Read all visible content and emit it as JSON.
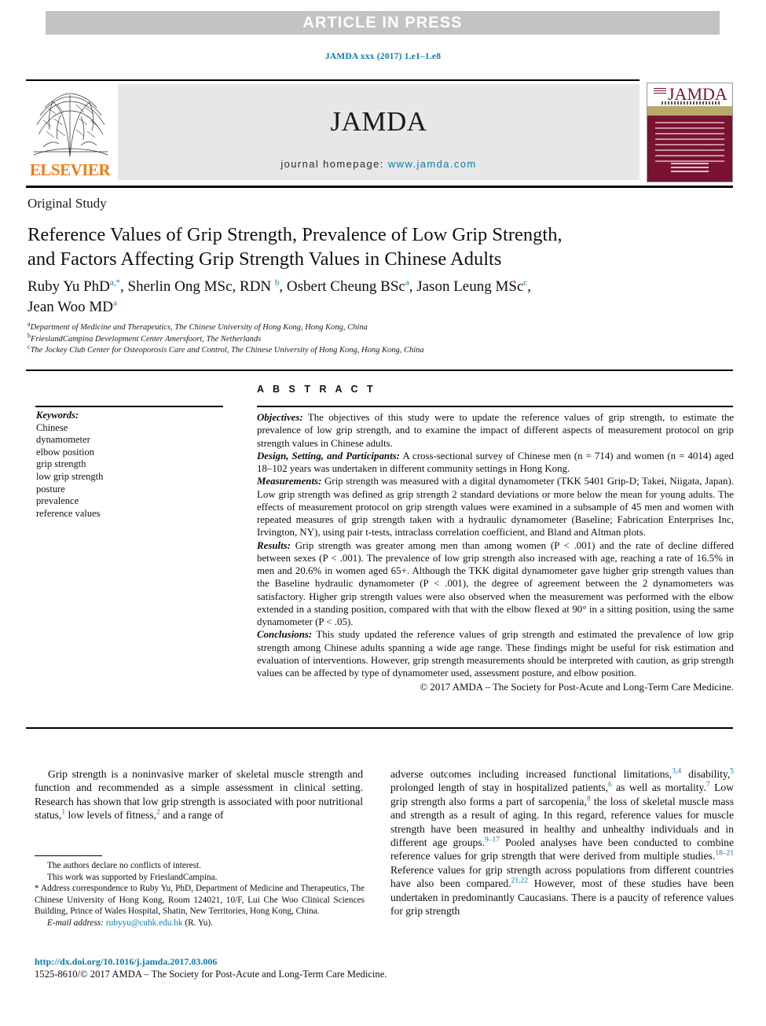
{
  "banner": {
    "text": "ARTICLE IN PRESS",
    "background": "#c3c3c3"
  },
  "citation": {
    "text": "JAMDA xxx (2017) 1.e1–1.e8",
    "color": "#0f7ba8"
  },
  "masthead": {
    "publisher": "ELSEVIER",
    "publisher_color": "#ef7c18",
    "journal_wordmark": "JAMDA",
    "homepage_label": "journal homepage:",
    "homepage_url": "www.jamda.com",
    "cover_title": "JAMDA",
    "cover_band_color": "#b5a96b",
    "cover_body_color": "#7a1330"
  },
  "article": {
    "section_label": "Original Study",
    "title_line1": "Reference Values of Grip Strength, Prevalence of Low Grip Strength,",
    "title_line2": "and Factors Affecting Grip Strength Values in Chinese Adults",
    "authors": [
      {
        "name": "Ruby Yu PhD",
        "sup": "a,*",
        "sep": ", "
      },
      {
        "name": "Sherlin Ong MSc, RDN",
        "sup": "b",
        "sep": ", "
      },
      {
        "name": "Osbert Cheung BSc",
        "sup": "a",
        "sep": ", "
      },
      {
        "name": "Jason Leung MSc",
        "sup": "c",
        "sep": ","
      },
      {
        "name": "Jean Woo MD",
        "sup": "a",
        "sep": ""
      }
    ],
    "affiliations": [
      {
        "marker": "a",
        "text": "Department of Medicine and Therapeutics, The Chinese University of Hong Kong, Hong Kong, China"
      },
      {
        "marker": "b",
        "text": "FrieslandCampina Development Center Amersfoort, The Netherlands"
      },
      {
        "marker": "c",
        "text": "The Jockey Club Center for Osteoporosis Care and Control, The Chinese University of Hong Kong, Hong Kong, China"
      }
    ]
  },
  "keywords": {
    "heading": "Keywords:",
    "items": [
      "Chinese",
      "dynamometer",
      "elbow position",
      "grip strength",
      "low grip strength",
      "posture",
      "prevalence",
      "reference values"
    ]
  },
  "abstract": {
    "heading": "A B S T R A C T",
    "sections": [
      {
        "label": "Objectives:",
        "body": " The objectives of this study were to update the reference values of grip strength, to estimate the prevalence of low grip strength, and to examine the impact of different aspects of measurement protocol on grip strength values in Chinese adults."
      },
      {
        "label": "Design, Setting, and Participants:",
        "body": " A cross-sectional survey of Chinese men (n = 714) and women (n = 4014) aged 18–102 years was undertaken in different community settings in Hong Kong."
      },
      {
        "label": "Measurements:",
        "body": " Grip strength was measured with a digital dynamometer (TKK 5401 Grip-D; Takei, Niigata, Japan). Low grip strength was defined as grip strength 2 standard deviations or more below the mean for young adults. The effects of measurement protocol on grip strength values were examined in a subsample of 45 men and women with repeated measures of grip strength taken with a hydraulic dynamometer (Baseline; Fabrication Enterprises Inc, Irvington, NY), using pair t-tests, intraclass correlation coefficient, and Bland and Altman plots."
      },
      {
        "label": "Results:",
        "body": " Grip strength was greater among men than among women (P < .001) and the rate of decline differed between sexes (P < .001). The prevalence of low grip strength also increased with age, reaching a rate of 16.5% in men and 20.6% in women aged 65+. Although the TKK digital dynamometer gave higher grip strength values than the Baseline hydraulic dynamometer (P < .001), the degree of agreement between the 2 dynamometers was satisfactory. Higher grip strength values were also observed when the measurement was performed with the elbow extended in a standing position, compared with that with the elbow flexed at 90° in a sitting position, using the same dynamometer (P < .05)."
      },
      {
        "label": "Conclusions:",
        "body": " This study updated the reference values of grip strength and estimated the prevalence of low grip strength among Chinese adults spanning a wide age range. These findings might be useful for risk estimation and evaluation of interventions. However, grip strength measurements should be interpreted with caution, as grip strength values can be affected by type of dynamometer used, assessment posture, and elbow position."
      }
    ],
    "copyright": "© 2017 AMDA – The Society for Post-Acute and Long-Term Care Medicine."
  },
  "body": {
    "left_column": {
      "part1": "Grip strength is a noninvasive marker of skeletal muscle strength and function and recommended as a simple assessment in clinical setting. Research has shown that low grip strength is associated with poor nutritional status,",
      "ref1": "1",
      "part2": " low levels of fitness,",
      "ref2": "2",
      "part3": " and a range of"
    },
    "right_column": {
      "part1": "adverse outcomes including increased functional limitations,",
      "ref1": "3,4",
      "part2": " disability,",
      "ref2": "5",
      "part3": " prolonged length of stay in hospitalized patients,",
      "ref3": "6",
      "part4": " as well as mortality.",
      "ref4": "7",
      "part5": " Low grip strength also forms a part of sarcopenia,",
      "ref5": "8",
      "part6": " the loss of skeletal muscle mass and strength as a result of aging. In this regard, reference values for muscle strength have been measured in healthy and unhealthy individuals and in different age groups.",
      "ref6": "9–17",
      "part7": " Pooled analyses have been conducted to combine reference values for grip strength that were derived from multiple studies.",
      "ref7": "18–21",
      "part8": " Reference values for grip strength across populations from different countries have also been compared.",
      "ref8": "21,22",
      "part9": " However, most of these studies have been undertaken in predominantly Caucasians. There is a paucity of reference values for grip strength"
    }
  },
  "footnotes": {
    "conflict": "The authors declare no conflicts of interest.",
    "funding": "This work was supported by FrieslandCampina.",
    "correspondence_marker": "*",
    "correspondence": " Address correspondence to Ruby Yu, PhD, Department of Medicine and Therapeutics, The Chinese University of Hong Kong, Room 124021, 10/F, Lui Che Woo Clinical Sciences Building, Prince of Wales Hospital, Shatin, New Territories, Hong Kong, China.",
    "email_label": "E-mail address:",
    "email": "rubyyu@cuhk.edu.hk",
    "email_suffix": " (R. Yu)."
  },
  "footer": {
    "doi": "http://dx.doi.org/10.1016/j.jamda.2017.03.006",
    "issn_line": "1525-8610/© 2017 AMDA – The Society for Post-Acute and Long-Term Care Medicine."
  }
}
